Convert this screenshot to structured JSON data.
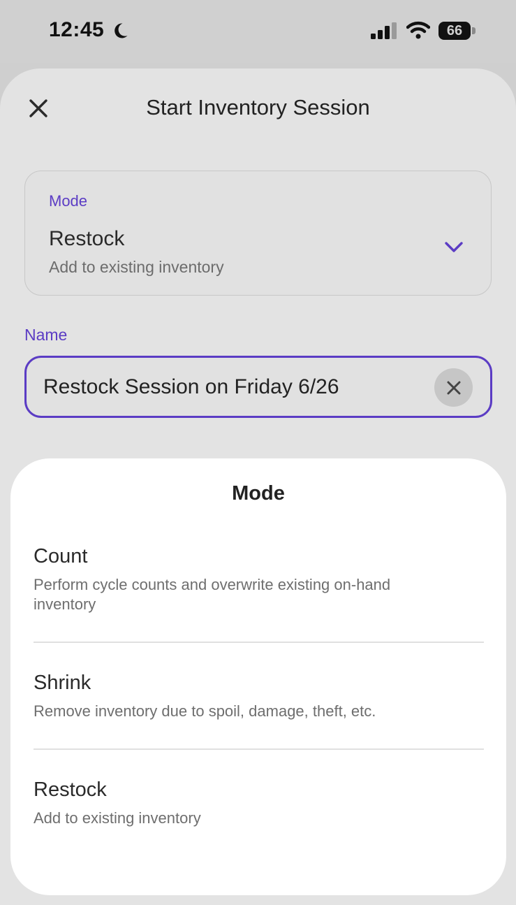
{
  "status_bar": {
    "time": "12:45",
    "battery_level": "66",
    "icons": [
      "moon-icon",
      "signal-icon",
      "wifi-icon",
      "battery-icon"
    ]
  },
  "header": {
    "title": "Start Inventory Session",
    "close_icon": "close-icon"
  },
  "mode_field": {
    "label": "Mode",
    "value": "Restock",
    "description": "Add to existing inventory",
    "icon": "chevron-down-icon"
  },
  "name_field": {
    "label": "Name",
    "value": "Restock Session on Friday 6/26",
    "clear_icon": "clear-icon"
  },
  "picker": {
    "title": "Mode",
    "options": [
      {
        "title": "Count",
        "description": "Perform cycle counts and overwrite existing on-hand inventory"
      },
      {
        "title": "Shrink",
        "description": "Remove inventory due to spoil, damage, theft, etc."
      },
      {
        "title": "Restock",
        "description": "Add to existing inventory"
      }
    ]
  },
  "colors": {
    "accent": "#5b3cc4",
    "overlay_background": "#e3e3e3",
    "sheet_background": "#ffffff"
  }
}
